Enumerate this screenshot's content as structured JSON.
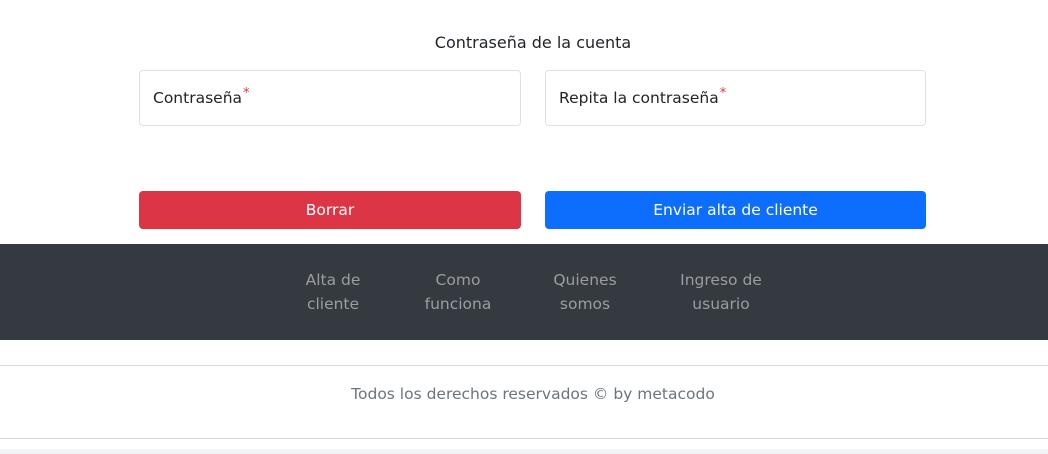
{
  "form": {
    "section_title": "Contraseña de la cuenta",
    "password_label": "Contraseña",
    "repeat_password_label": "Repita la contraseña",
    "required_marker": "*",
    "clear_button": "Borrar",
    "submit_button": "Enviar alta de cliente"
  },
  "nav": {
    "items": [
      {
        "line1": "Alta de",
        "line2": "cliente"
      },
      {
        "line1": "Como",
        "line2": "funciona"
      },
      {
        "line1": "Quienes",
        "line2": "somos"
      },
      {
        "line1": "Ingreso de",
        "line2": "usuario"
      }
    ]
  },
  "footer": {
    "copyright": "Todos los derechos reservados © by metacodo"
  },
  "colors": {
    "danger": "#dc3545",
    "primary": "#0d6efd",
    "navbar": "#343a40",
    "nav_link": "#9a9da1",
    "muted_text": "#6c757d"
  }
}
